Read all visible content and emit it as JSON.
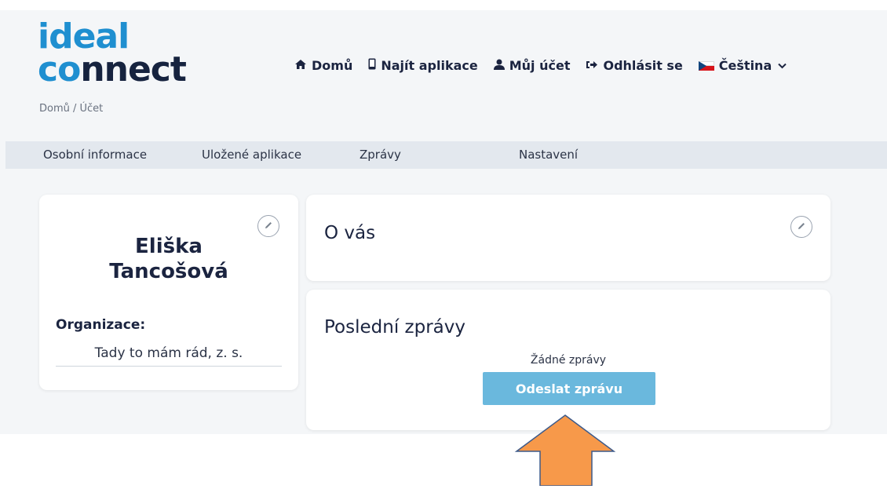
{
  "logo": {
    "line1_i": "i",
    "line1_rest": "deal",
    "line2_c": "co",
    "line2_rest": "nnect"
  },
  "nav": {
    "items": [
      {
        "icon": "home-icon",
        "label": "Domů"
      },
      {
        "icon": "mobile-phone-icon",
        "label": "Najít aplikace"
      },
      {
        "icon": "user-icon",
        "label": "Můj účet"
      },
      {
        "icon": "sign-out-icon",
        "label": "Odhlásit se"
      }
    ],
    "language": {
      "flag": "czech-flag-icon",
      "label": "Čeština"
    }
  },
  "breadcrumb": "Domů / Účet",
  "tabs": [
    "Osobní informace",
    "Uložené aplikace",
    "Zprávy",
    "Nastavení"
  ],
  "profile": {
    "first_name": "Eliška",
    "last_name": "Tancošová",
    "org_label": "Organizace:",
    "org_value": "Tady to mám rád, z. s."
  },
  "about": {
    "title": "O vás"
  },
  "messages": {
    "title": "Poslední zprávy",
    "empty_text": "Žádné zprávy",
    "send_label": "Odeslat zprávu"
  },
  "colors": {
    "accent": "#1f8fd0",
    "button": "#6ab8dd",
    "arrow": "#f7994a"
  }
}
